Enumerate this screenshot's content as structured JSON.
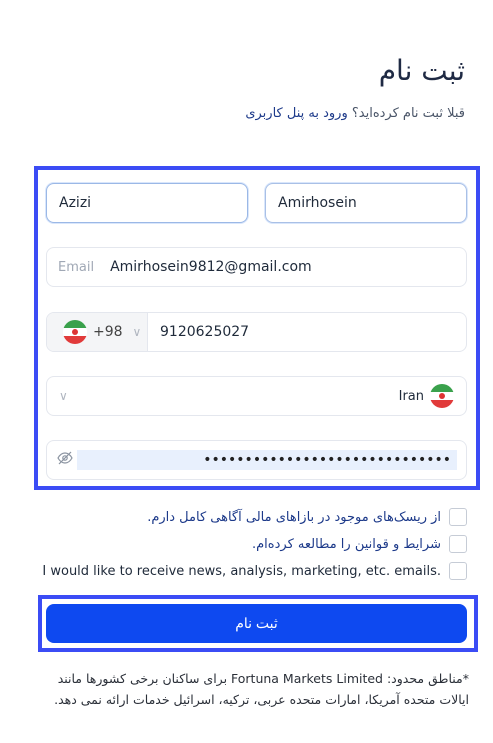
{
  "page": {
    "title": "ثبت نام",
    "login_prompt": "قبلا ثبت نام کرده‌اید؟",
    "login_link": "ورود به پنل کاربری"
  },
  "form": {
    "last_name": "Azizi",
    "first_name": "Amirhosein",
    "email_label": "Email",
    "email_value": "Amirhosein9812@gmail.com",
    "phone_code": "+98",
    "phone_number": "9120625027",
    "country": "Iran",
    "password_masked": "••••••••••••••••••••••••••••••"
  },
  "checkboxes": [
    {
      "label": "از ریسک‌های موجود در بازاهای مالی آگاهی کامل دارم.",
      "checked": false
    },
    {
      "label": "شرایط و قوانین را مطالعه کرده‌ام.",
      "checked": false
    },
    {
      "label": "I would like to receive news, analysis, marketing, etc. emails.",
      "checked": false
    }
  ],
  "submit_label": "ثبت نام",
  "note": "*مناطق محدود: Fortuna Markets Limited برای ساکنان برخی کشورها مانند ایالات متحده آمریکا، امارات متحده عربی، ترکیه، اسرائیل خدمات ارائه نمی دهد.",
  "colors": {
    "accent": "#0e49f0",
    "highlight": "#3b4cf5",
    "link": "#1d3a8a"
  }
}
